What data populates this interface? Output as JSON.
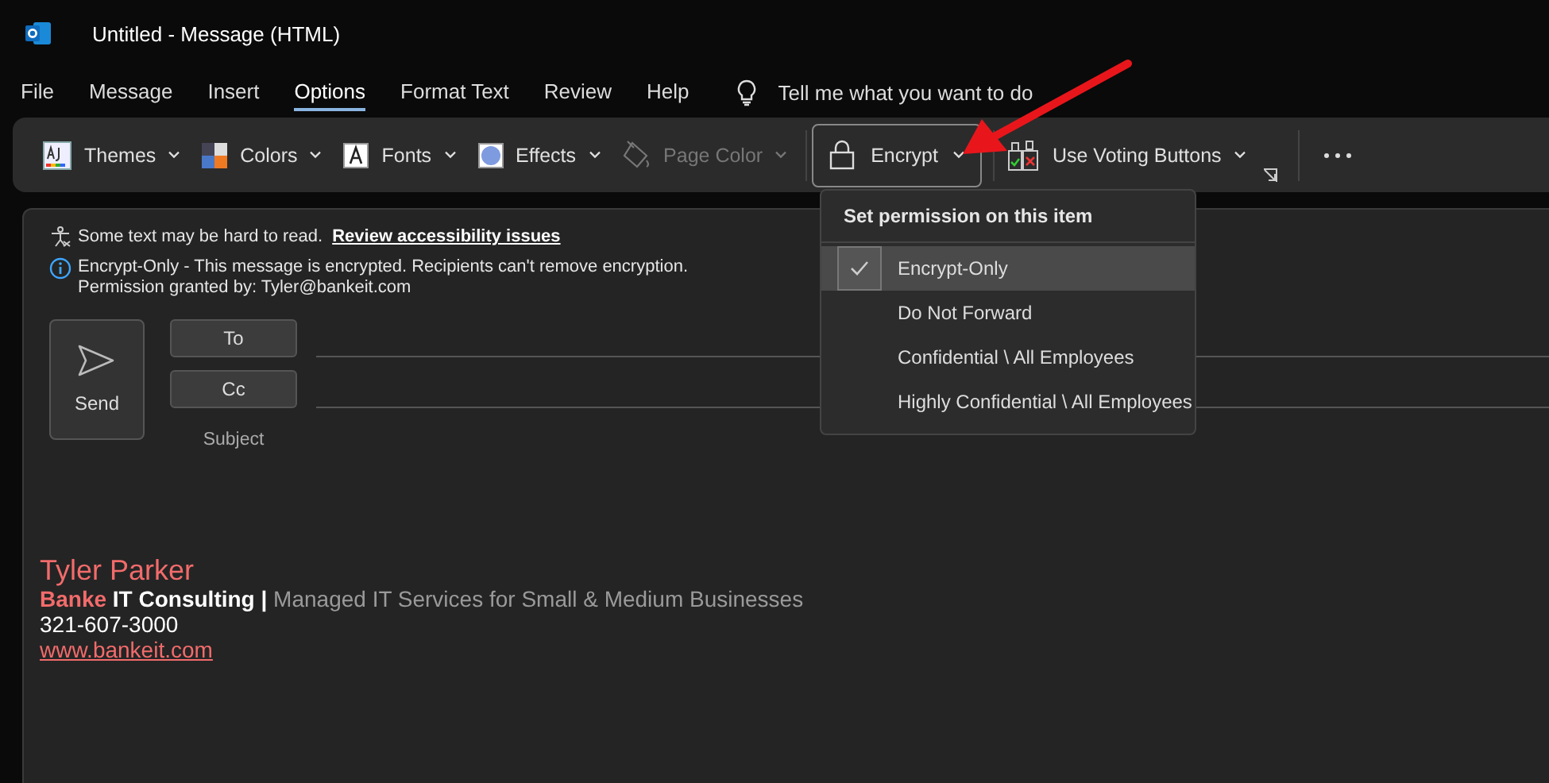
{
  "window": {
    "title": "Untitled  -  Message (HTML)"
  },
  "tabs": [
    {
      "label": "File",
      "selected": false
    },
    {
      "label": "Message",
      "selected": false
    },
    {
      "label": "Insert",
      "selected": false
    },
    {
      "label": "Options",
      "selected": true
    },
    {
      "label": "Format Text",
      "selected": false
    },
    {
      "label": "Review",
      "selected": false
    },
    {
      "label": "Help",
      "selected": false
    }
  ],
  "tell_me": {
    "placeholder": "Tell me what you want to do"
  },
  "ribbon": [
    {
      "kind": "themes",
      "label": "Themes",
      "disabled": false
    },
    {
      "kind": "colors",
      "label": "Colors",
      "disabled": false
    },
    {
      "kind": "fonts",
      "label": "Fonts",
      "disabled": false
    },
    {
      "kind": "effects",
      "label": "Effects",
      "disabled": false
    },
    {
      "kind": "pagecolor",
      "label": "Page Color",
      "disabled": true
    },
    {
      "kind": "encrypt",
      "label": "Encrypt",
      "disabled": false,
      "expanded": true
    },
    {
      "kind": "voting",
      "label": "Use Voting Buttons",
      "disabled": false
    }
  ],
  "encrypt_menu": {
    "heading": "Set permission on this item",
    "items": [
      {
        "label": "Encrypt-Only",
        "selected": true
      },
      {
        "label": "Do Not Forward",
        "selected": false
      },
      {
        "label": "Confidential \\ All Employees",
        "selected": false
      },
      {
        "label": "Highly Confidential \\ All Employees",
        "selected": false
      }
    ]
  },
  "infobar": {
    "accessibility": "Some text may be hard to read.",
    "accessibility_link": "Review accessibility issues",
    "encryption": "Encrypt-Only - This message is encrypted. Recipients can't remove encryption.",
    "permission": "Permission granted by: Tyler@bankeit.com"
  },
  "compose": {
    "send": "Send",
    "to": "To",
    "cc": "Cc",
    "subject": "Subject"
  },
  "signature": {
    "name": "Tyler Parker",
    "tagline": [
      {
        "kind": "accent",
        "text": "Banke"
      },
      {
        "kind": "strong",
        "text": "IT Consulting |"
      },
      {
        "kind": "muted",
        "text": "Managed IT Services for Small & Medium Businesses"
      }
    ],
    "phone": "321-607-3000",
    "website": "www.bankeit.com"
  }
}
